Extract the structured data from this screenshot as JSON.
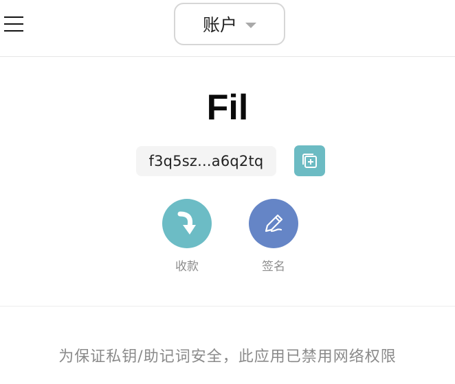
{
  "header": {
    "menu_icon": "hamburger-menu-icon",
    "account_selector": {
      "label": "账户",
      "icon": "caret-down-icon"
    }
  },
  "wallet": {
    "coin": "Fil",
    "address": "f3q5sz...a6q2tq",
    "copy_icon": "copy-plus-icon"
  },
  "actions": [
    {
      "label": "收款",
      "icon": "receive-arrow-icon",
      "color": "#6cbcc5"
    },
    {
      "label": "签名",
      "icon": "pen-icon",
      "color": "#6585c6"
    }
  ],
  "notice": "为保证私钥/助记词安全，此应用已禁用网络权限",
  "colors": {
    "accent_teal": "#6cbcc5",
    "accent_blue": "#6585c6",
    "muted_text": "#8c8c8c"
  }
}
